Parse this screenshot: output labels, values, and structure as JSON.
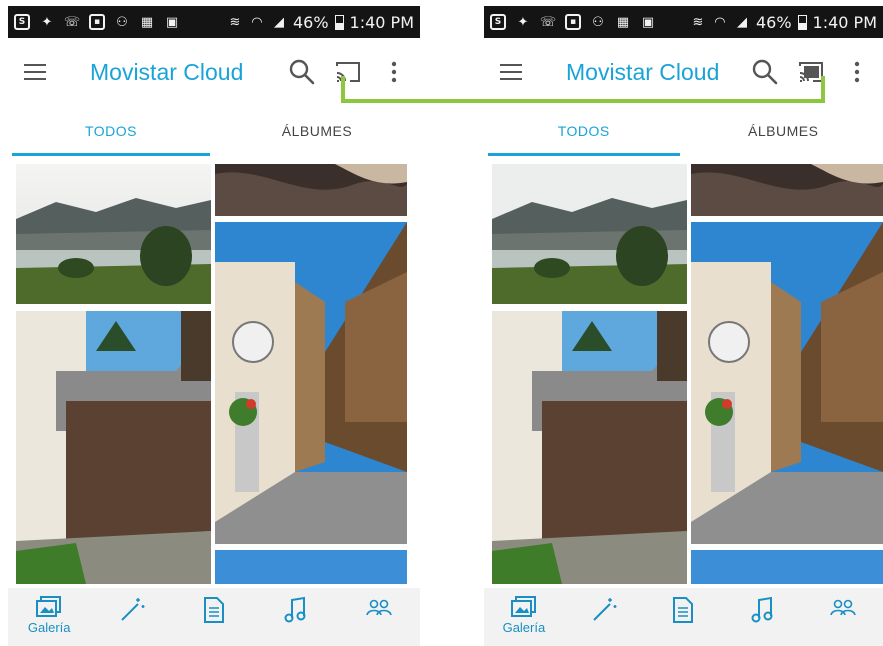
{
  "colors": {
    "accent": "#1aa3d9",
    "status_bar": "#141414",
    "highlight_connector": "#8dc63f",
    "bottom_nav_bg": "#f2f2f2"
  },
  "screens": [
    {
      "status": {
        "battery": "46%",
        "time": "1:40 PM",
        "cast_state": "idle"
      },
      "app_title": "Movistar Cloud",
      "tabs": [
        {
          "label": "TODOS",
          "active": true
        },
        {
          "label": "ÁLBUMES",
          "active": false
        }
      ],
      "bottom_nav": {
        "gallery_label": "Galería"
      }
    },
    {
      "status": {
        "battery": "46%",
        "time": "1:40 PM",
        "cast_state": "connected"
      },
      "app_title": "Movistar Cloud",
      "tabs": [
        {
          "label": "TODOS",
          "active": true
        },
        {
          "label": "ÁLBUMES",
          "active": false
        }
      ],
      "bottom_nav": {
        "gallery_label": "Galería"
      }
    }
  ],
  "icons": {
    "status_left": [
      "skype-icon",
      "twitter-icon",
      "missed-call-icon",
      "image-icon",
      "add-contact-icon",
      "calendar-icon",
      "clipboard-icon",
      "vibrate-icon",
      "wifi-icon",
      "signal-icon"
    ],
    "toolbar": [
      "menu-icon",
      "search-icon",
      "cast-icon",
      "more-vert-icon"
    ],
    "bottom_nav": [
      "gallery-icon",
      "magic-wand-icon",
      "document-icon",
      "music-icon",
      "people-icon"
    ]
  }
}
